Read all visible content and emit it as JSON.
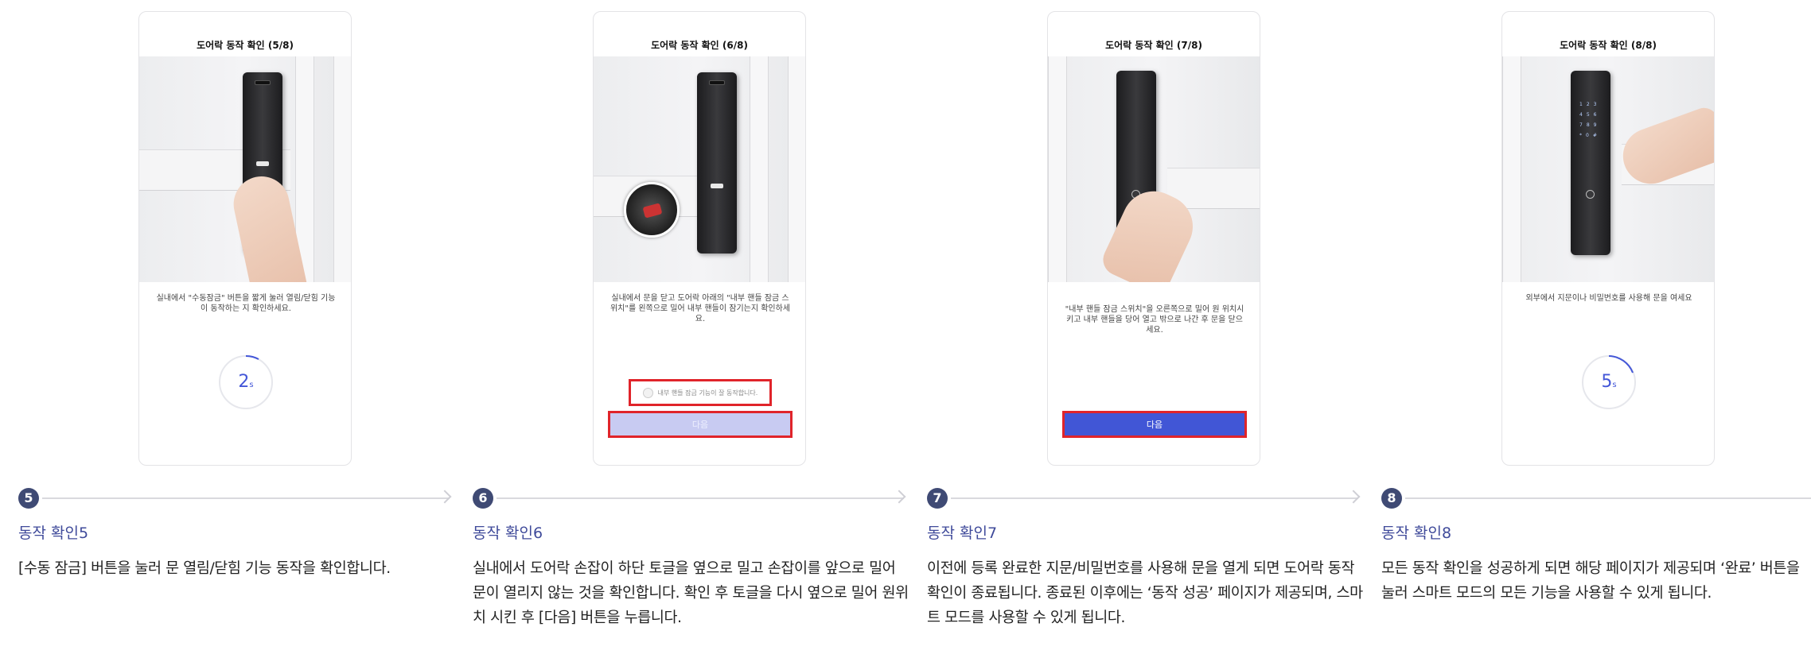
{
  "steps": [
    {
      "number": "5",
      "phone_title": "도어락 동작 확인 (5/8)",
      "instruction": "실내에서 \"수동잠금\" 버튼을 짧게 눌러 열림/닫힘 기능이 동작하는 지 확인하세요.",
      "timer_value": "2",
      "timer_unit": "s",
      "heading": "동작 확인5",
      "description": "[수동 잠금] 버튼을 눌러 문 열림/닫힘 기능 동작을 확인합니다."
    },
    {
      "number": "6",
      "phone_title": "도어락 동작 확인 (6/8)",
      "instruction": "실내에서 문을 닫고 도어락 아래의 \"내부 핸들 잠금 스위치\"를 왼쪽으로 밀어 내부 핸들이 잠기는지 확인하세요.",
      "checkbox_label": "내부 핸들 잠금 기능이 잘 동작합니다.",
      "next_label": "다음",
      "heading": "동작 확인6",
      "description": "실내에서 도어락 손잡이 하단 토글을 옆으로 밀고 손잡이를 앞으로 밀어 문이 열리지 않는 것을 확인합니다. 확인 후 토글을 다시 옆으로 밀어 원위치 시킨 후 [다음] 버튼을 누릅니다."
    },
    {
      "number": "7",
      "phone_title": "도어락 동작 확인 (7/8)",
      "instruction": "\"내부 핸들 잠금 스위치\"을 오른쪽으로 밀어 원 위치시키고 내부 핸들을 당어 열고 밖으로 나간 후 문을 닫으세요.",
      "next_label": "다음",
      "heading": "동작 확인7",
      "description": "이전에 등록 완료한 지문/비밀번호를 사용해 문을 열게 되면 도어락 동작 확인이 종료됩니다. 종료된 이후에는 ‘동작 성공’ 페이지가 제공되며, 스마트 모드를 사용할 수 있게 됩니다."
    },
    {
      "number": "8",
      "phone_title": "도어락 동작 확인 (8/8)",
      "instruction": "외부에서 지문이나 비밀번호를 사용해 문을 여세요",
      "timer_value": "5",
      "timer_unit": "s",
      "heading": "동작 확인8",
      "description": "모든 동작 확인을 성공하게 되면 해당 페이지가 제공되며 ‘완료’ 버튼을 눌러 스마트 모드의 모든 기능을 사용할 수 있게 됩니다."
    }
  ],
  "colors": {
    "accent": "#4156d6",
    "badge": "#3f4a74",
    "heading": "#3f4a9a",
    "highlight_border": "#e0242a",
    "disabled_button": "#c8cbf2"
  }
}
